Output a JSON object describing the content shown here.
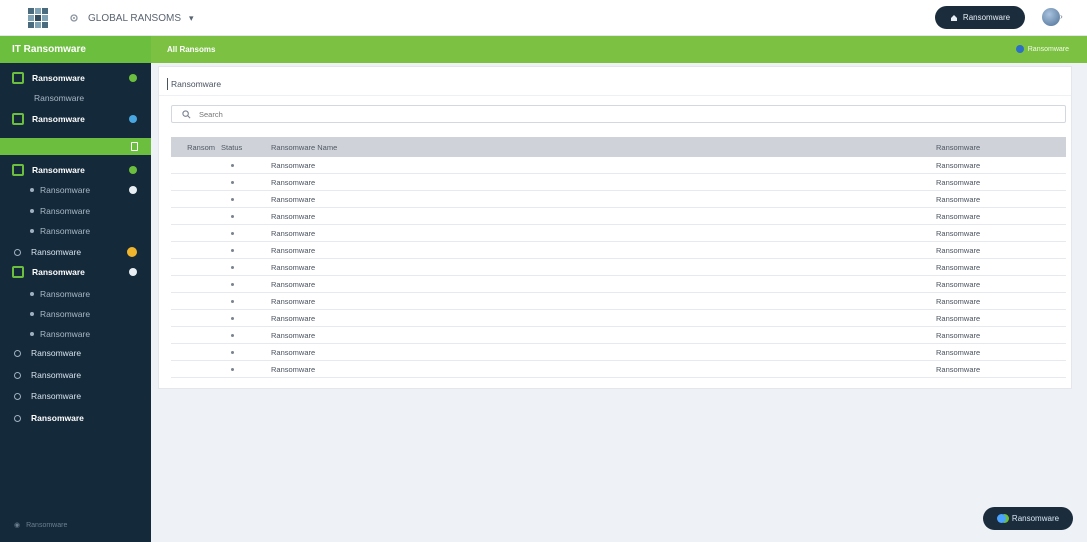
{
  "topbar": {
    "org_label": "GLOBAL RANSOMS",
    "action_button": "Ransomware"
  },
  "sidebar": {
    "header": "IT Ransomware",
    "items": [
      {
        "label": "Ransomware"
      },
      {
        "label": "Ransomware"
      },
      {
        "label": "Ransomware"
      },
      {
        "label": "Ransomware"
      },
      {
        "label": "Ransomware"
      },
      {
        "label": "Ransomware"
      },
      {
        "label": "Ransomware"
      },
      {
        "label": "Ransomware"
      },
      {
        "label": "Ransomware"
      },
      {
        "label": "Ransomware"
      },
      {
        "label": "Ransomware"
      },
      {
        "label": "Ransomware"
      },
      {
        "label": "Ransomware"
      },
      {
        "label": "Ransomware"
      },
      {
        "label": "Ransomware"
      }
    ],
    "footer": "Ransomware"
  },
  "main": {
    "header_left": "All Ransoms",
    "header_right": "Ransomware"
  },
  "panel": {
    "title": "Ransomware",
    "search_placeholder": "Search"
  },
  "table": {
    "headers": {
      "col1": "Ransom",
      "col2": "Status",
      "col3": "Ransomware Name",
      "col4": "Ransomware"
    },
    "rows": [
      {
        "name": "Ransomware",
        "type": "Ransomware"
      },
      {
        "name": "Ransomware",
        "type": "Ransomware"
      },
      {
        "name": "Ransomware",
        "type": "Ransomware"
      },
      {
        "name": "Ransomware",
        "type": "Ransomware"
      },
      {
        "name": "Ransomware",
        "type": "Ransomware"
      },
      {
        "name": "Ransomware",
        "type": "Ransomware"
      },
      {
        "name": "Ransomware",
        "type": "Ransomware"
      },
      {
        "name": "Ransomware",
        "type": "Ransomware"
      },
      {
        "name": "Ransomware",
        "type": "Ransomware"
      },
      {
        "name": "Ransomware",
        "type": "Ransomware"
      },
      {
        "name": "Ransomware",
        "type": "Ransomware"
      },
      {
        "name": "Ransomware",
        "type": "Ransomware"
      },
      {
        "name": "Ransomware",
        "type": "Ransomware"
      }
    ]
  },
  "fab": {
    "label": "Ransomware"
  },
  "colors": {
    "accent_green": "#6cbf3e",
    "sidebar_bg": "#14293a",
    "button_dark": "#1b2c3d",
    "badge_yellow": "#f0b52c"
  },
  "icons": {
    "logo": "app-logo-icon",
    "settings": "gear-icon",
    "search": "search-icon",
    "user": "avatar-icon"
  }
}
